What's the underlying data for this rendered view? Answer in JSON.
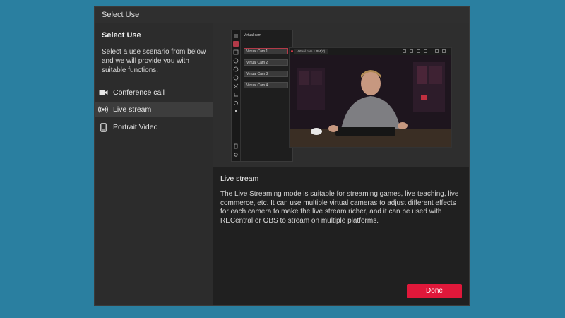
{
  "window": {
    "title": "Select Use"
  },
  "sidebar": {
    "heading": "Select Use",
    "description": "Select a use scenario from below and we will provide you with suitable functions.",
    "items": [
      {
        "label": "Conference call",
        "icon": "video-camera-icon",
        "active": false
      },
      {
        "label": "Live stream",
        "icon": "broadcast-icon",
        "active": true
      },
      {
        "label": "Portrait Video",
        "icon": "phone-portrait-icon",
        "active": false
      }
    ]
  },
  "preview": {
    "app_title": "Virtual cam",
    "virtual_cams": [
      "Virtual Cam 1",
      "Virtual Cam 2",
      "Virtual Cam 3",
      "Virtual Cam 4"
    ],
    "video_window_tab": "Virtual cam 1 PM(V)"
  },
  "content": {
    "title": "Live stream",
    "body": "The Live Streaming mode is suitable for streaming games, live teaching, live commerce, etc. It can use multiple virtual cameras to adjust different effects for each camera to make the live stream richer, and it can be used with RECentral or OBS to stream on multiple platforms."
  },
  "footer": {
    "done_label": "Done"
  },
  "colors": {
    "accent": "#e0183a",
    "background": "#2a7fa0",
    "panel": "#262626"
  }
}
